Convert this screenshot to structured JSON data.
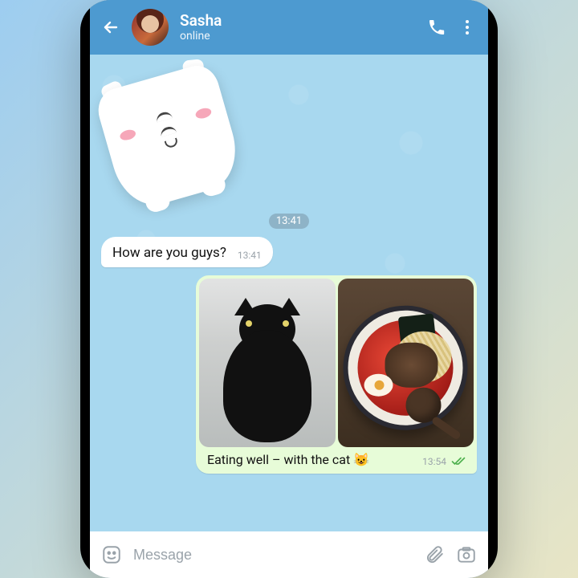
{
  "header": {
    "name": "Sasha",
    "status": "online"
  },
  "messages": {
    "sticker_time": "13:41",
    "incoming_text": "How are you guys?",
    "incoming_time": "13:41",
    "outgoing_caption": "Eating well – with the cat 😺",
    "outgoing_time": "13:54"
  },
  "input": {
    "placeholder": "Message"
  }
}
